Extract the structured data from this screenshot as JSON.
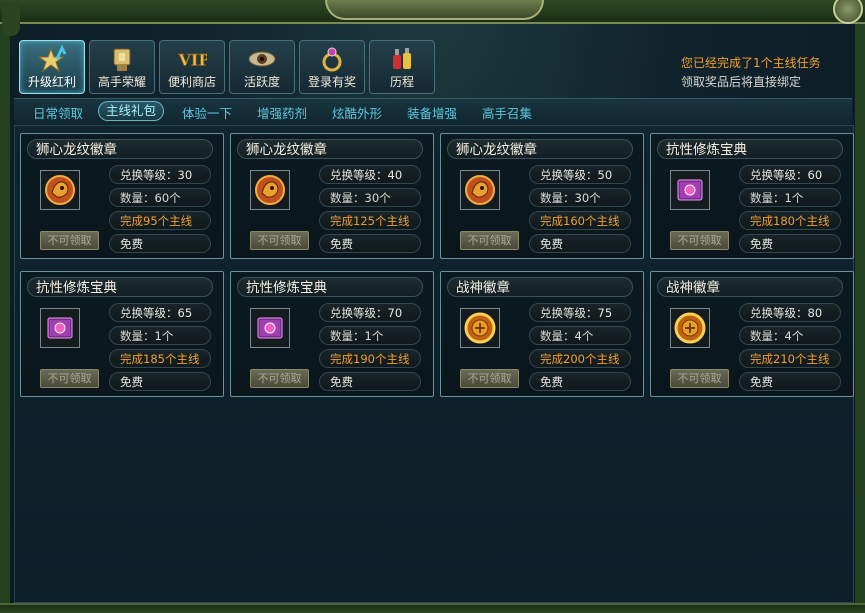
{
  "notice": {
    "line1": "您已经完成了1个主线任务",
    "line2": "领取奖品后将直接绑定"
  },
  "main_tabs": [
    {
      "label": "升级红利",
      "icon": "star-arrow-icon",
      "active": true
    },
    {
      "label": "高手荣耀",
      "icon": "trophy-icon",
      "active": false
    },
    {
      "label": "便利商店",
      "icon": "vip-icon",
      "active": false
    },
    {
      "label": "活跃度",
      "icon": "eye-icon",
      "active": false
    },
    {
      "label": "登录有奖",
      "icon": "ring-icon",
      "active": false
    },
    {
      "label": "历程",
      "icon": "potion-icon",
      "active": false
    }
  ],
  "sub_tabs": [
    {
      "label": "日常领取",
      "active": false
    },
    {
      "label": "主线礼包",
      "active": true
    },
    {
      "label": "体验一下",
      "active": false
    },
    {
      "label": "增强药剂",
      "active": false
    },
    {
      "label": "炫酷外形",
      "active": false
    },
    {
      "label": "装备增强",
      "active": false
    },
    {
      "label": "高手召集",
      "active": false
    }
  ],
  "cards": [
    {
      "title": "狮心龙纹徽章",
      "level": "兑换等级：30",
      "qty": "数量：60个",
      "req": "完成95个主线",
      "cost": "免费",
      "button": "不可领取",
      "icon": "lion-badge-icon"
    },
    {
      "title": "狮心龙纹徽章",
      "level": "兑换等级：40",
      "qty": "数量：30个",
      "req": "完成125个主线",
      "cost": "免费",
      "button": "不可领取",
      "icon": "lion-badge-icon"
    },
    {
      "title": "狮心龙纹徽章",
      "level": "兑换等级：50",
      "qty": "数量：30个",
      "req": "完成160个主线",
      "cost": "免费",
      "button": "不可领取",
      "icon": "lion-badge-icon"
    },
    {
      "title": "抗性修炼宝典",
      "level": "兑换等级：60",
      "qty": "数量：1个",
      "req": "完成180个主线",
      "cost": "免费",
      "button": "不可领取",
      "icon": "spellbook-icon"
    },
    {
      "title": "抗性修炼宝典",
      "level": "兑换等级：65",
      "qty": "数量：1个",
      "req": "完成185个主线",
      "cost": "免费",
      "button": "不可领取",
      "icon": "spellbook-icon"
    },
    {
      "title": "抗性修炼宝典",
      "level": "兑换等级：70",
      "qty": "数量：1个",
      "req": "完成190个主线",
      "cost": "免费",
      "button": "不可领取",
      "icon": "spellbook-icon"
    },
    {
      "title": "战神徽章",
      "level": "兑换等级：75",
      "qty": "数量：4个",
      "req": "完成200个主线",
      "cost": "免费",
      "button": "不可领取",
      "icon": "war-god-badge-icon"
    },
    {
      "title": "战神徽章",
      "level": "兑换等级：80",
      "qty": "数量：4个",
      "req": "完成210个主线",
      "cost": "免费",
      "button": "不可领取",
      "icon": "war-god-badge-icon"
    }
  ]
}
